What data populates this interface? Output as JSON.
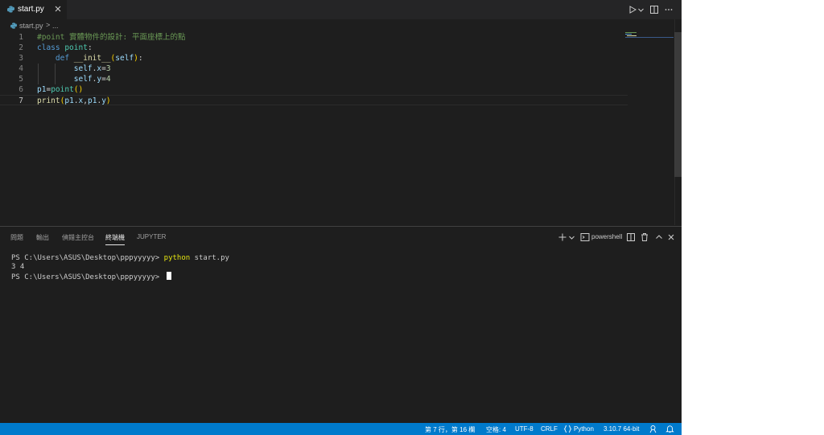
{
  "tabs": [
    {
      "label": "start.py",
      "active": true
    }
  ],
  "breadcrumb": {
    "file": "start.py",
    "separator": ">",
    "more": "..."
  },
  "editor": {
    "active_line": 7,
    "line_numbers": [
      "1",
      "2",
      "3",
      "4",
      "5",
      "6",
      "7"
    ],
    "lines": [
      [
        {
          "t": "#point 實體物件的設計: 平面座標上的點",
          "c": "comment"
        }
      ],
      [
        {
          "t": "class ",
          "c": "kw"
        },
        {
          "t": "point",
          "c": "cls"
        },
        {
          "t": ":",
          "c": "plain"
        }
      ],
      [
        {
          "t": "    ",
          "c": "plain"
        },
        {
          "t": "def ",
          "c": "kw"
        },
        {
          "t": "__init__",
          "c": "fn"
        },
        {
          "t": "(",
          "c": "br1"
        },
        {
          "t": "self",
          "c": "var"
        },
        {
          "t": ")",
          "c": "br1"
        },
        {
          "t": ":",
          "c": "plain"
        }
      ],
      [
        {
          "t": "        ",
          "c": "plain"
        },
        {
          "t": "self",
          "c": "var"
        },
        {
          "t": ".",
          "c": "plain"
        },
        {
          "t": "x",
          "c": "var"
        },
        {
          "t": "=",
          "c": "plain"
        },
        {
          "t": "3",
          "c": "num"
        }
      ],
      [
        {
          "t": "        ",
          "c": "plain"
        },
        {
          "t": "self",
          "c": "var"
        },
        {
          "t": ".",
          "c": "plain"
        },
        {
          "t": "y",
          "c": "var"
        },
        {
          "t": "=",
          "c": "plain"
        },
        {
          "t": "4",
          "c": "num"
        }
      ],
      [
        {
          "t": "p1",
          "c": "var"
        },
        {
          "t": "=",
          "c": "plain"
        },
        {
          "t": "point",
          "c": "cls"
        },
        {
          "t": "()",
          "c": "br1"
        }
      ],
      [
        {
          "t": "print",
          "c": "fn"
        },
        {
          "t": "(",
          "c": "br1"
        },
        {
          "t": "p1",
          "c": "var"
        },
        {
          "t": ".",
          "c": "plain"
        },
        {
          "t": "x",
          "c": "var"
        },
        {
          "t": ",",
          "c": "plain"
        },
        {
          "t": "p1",
          "c": "var"
        },
        {
          "t": ".",
          "c": "plain"
        },
        {
          "t": "y",
          "c": "var"
        },
        {
          "t": ")",
          "c": "br1"
        }
      ]
    ]
  },
  "panel": {
    "tabs": [
      {
        "label": "問題",
        "active": false
      },
      {
        "label": "輸出",
        "active": false
      },
      {
        "label": "偵錯主控台",
        "active": false
      },
      {
        "label": "終端機",
        "active": true
      },
      {
        "label": "JUPYTER",
        "active": false
      }
    ],
    "shell_label": "powershell",
    "terminal": {
      "prompt1": "PS C:\\Users\\ASUS\\Desktop\\pppyyyyy> ",
      "command": "python",
      "args": " start.py",
      "output": "3 4",
      "prompt2": "PS C:\\Users\\ASUS\\Desktop\\pppyyyyy> "
    }
  },
  "statusbar": {
    "position": "第 7 行，第 16 欄",
    "spaces": "空格: 4",
    "encoding": "UTF-8",
    "eol": "CRLF",
    "language": "Python",
    "interpreter": "3.10.7 64-bit"
  },
  "colors": {
    "accent": "#007acc",
    "editor_bg": "#1e1e1e",
    "tabbar_bg": "#252526",
    "python_icon": "#519aba",
    "terminal_cmd": "#e5e510"
  },
  "icons": {
    "file": "python-file-icon",
    "run": "run-icon",
    "split": "split-editor-icon",
    "more": "more-actions-icon",
    "close": "close-icon",
    "add": "add-terminal-icon",
    "terminal": "terminal-icon",
    "trash": "trash-icon",
    "maximize": "chevron-up-icon",
    "feedback": "feedback-icon",
    "bell": "bell-icon",
    "braces": "braces-icon"
  }
}
